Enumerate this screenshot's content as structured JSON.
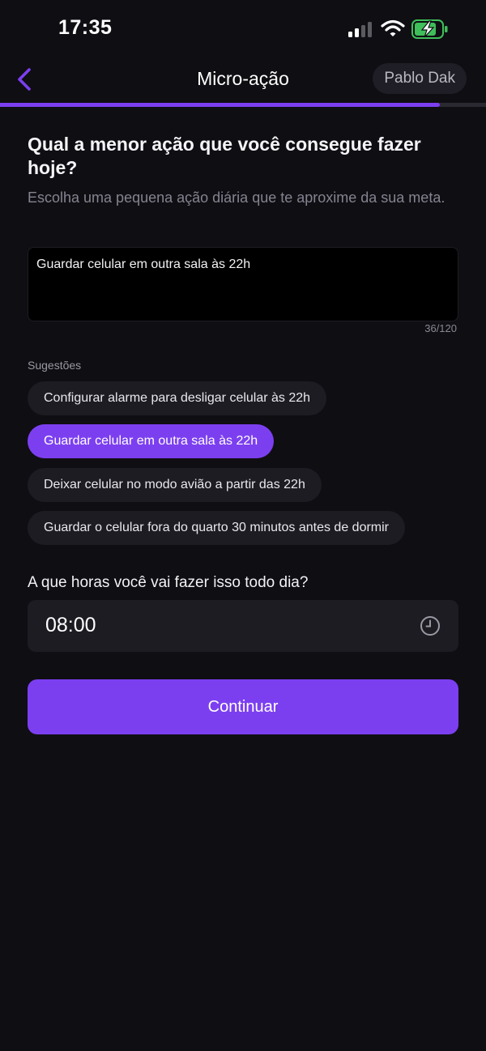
{
  "status_bar": {
    "time": "17:35"
  },
  "nav": {
    "title": "Micro-ação",
    "user_name": "Pablo Dak",
    "progress_fraction": 0.905
  },
  "main": {
    "question": "Qual a menor ação que você consegue fazer hoje?",
    "subtitle": "Escolha uma pequena ação diária que te aproxime da sua meta.",
    "input_value": "Guardar celular em outra sala às 22h",
    "char_count": "36/120",
    "suggestions_label": "Sugestões",
    "suggestions": [
      {
        "label": "Configurar alarme para desligar celular às 22h",
        "selected": false
      },
      {
        "label": "Guardar celular em outra sala às 22h",
        "selected": true
      },
      {
        "label": "Deixar celular no modo avião a partir das 22h",
        "selected": false
      },
      {
        "label": "Guardar o celular fora do quarto 30 minutos antes de dormir",
        "selected": false
      }
    ],
    "time_question": "A que horas você vai fazer isso todo dia?",
    "time_value": "08:00",
    "continue_label": "Continuar"
  },
  "colors": {
    "background": "#0f0e13",
    "accent": "#7c3ff0",
    "surface": "#1d1c23"
  },
  "icons": [
    "signal-icon",
    "wifi-icon",
    "battery-charging-icon",
    "back-chevron-icon",
    "clock-icon"
  ]
}
